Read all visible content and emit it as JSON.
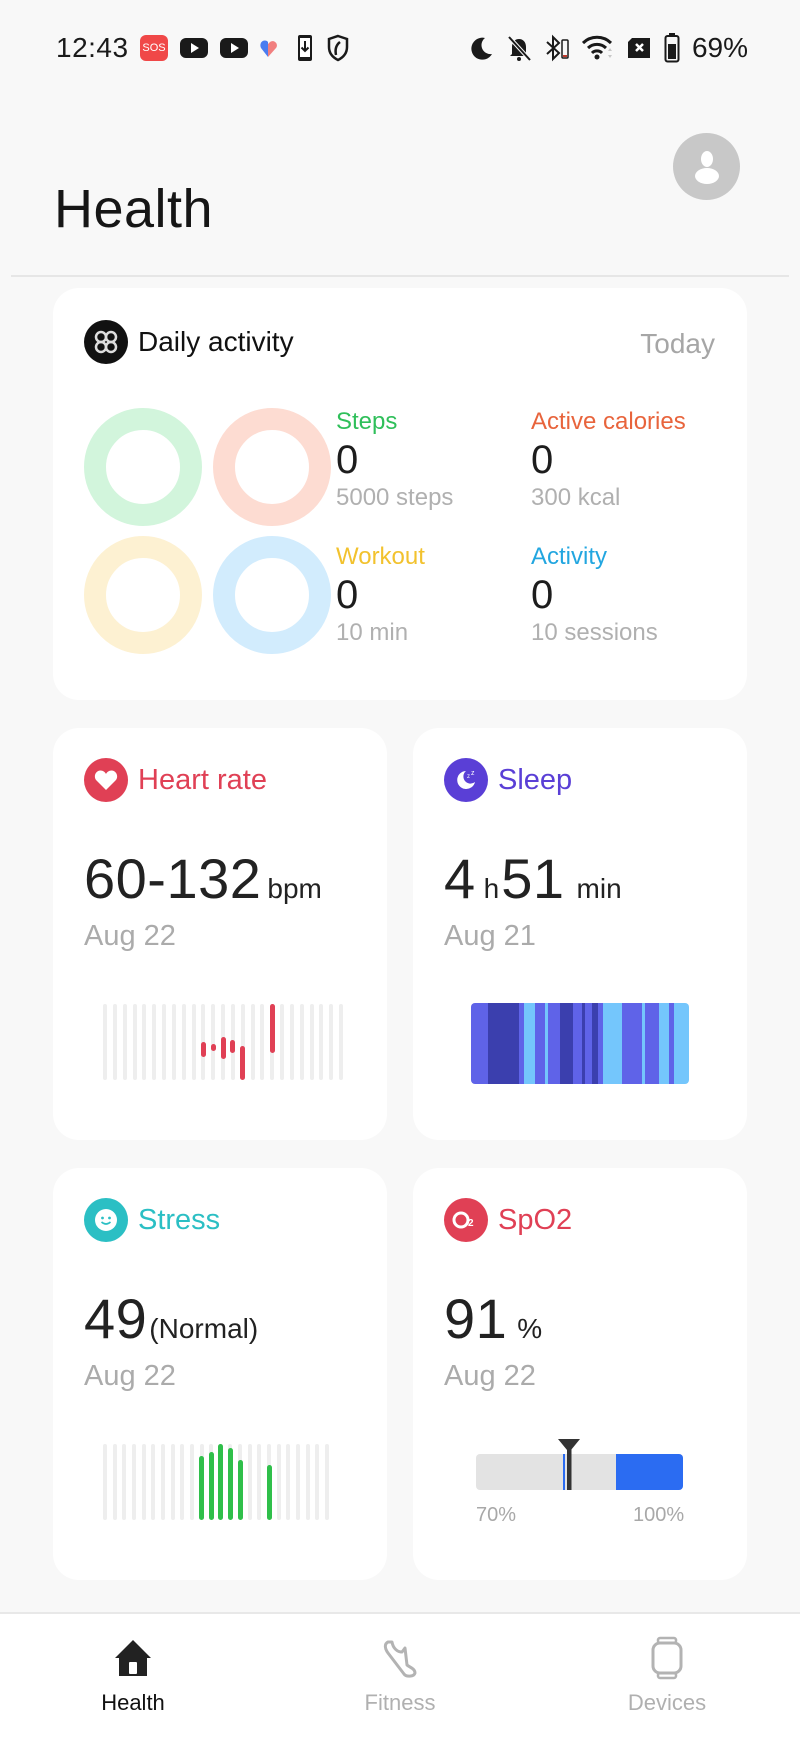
{
  "status_bar": {
    "time": "12:43",
    "left_icons": [
      "sos-icon",
      "youtube-icon",
      "youtube-icon",
      "health-heart-icon",
      "phone-download-icon",
      "shield-icon"
    ],
    "right_icons": [
      "do-not-disturb-moon-icon",
      "bell-muted-icon",
      "bluetooth-battery-icon",
      "wifi-icon",
      "no-sim-icon",
      "battery-icon"
    ],
    "sos_label": "SOS",
    "battery_percent": "69%"
  },
  "header": {
    "title": "Health",
    "avatar_icon": "user-avatar-icon"
  },
  "daily_activity": {
    "title": "Daily activity",
    "icon": "activity-rings-icon",
    "period": "Today",
    "metrics": [
      {
        "label": "Steps",
        "value": "0",
        "goal": "5000 steps",
        "color": "#2fbf5a",
        "ring_color": "#d2f5dc",
        "progress": 0
      },
      {
        "label": "Active calories",
        "value": "0",
        "goal": "300 kcal",
        "color": "#e8643c",
        "ring_color": "#fddcd2",
        "progress": 0
      },
      {
        "label": "Workout",
        "value": "0",
        "goal": "10 min",
        "color": "#f2c22e",
        "ring_color": "#fdf1d2",
        "progress": 0
      },
      {
        "label": "Activity",
        "value": "0",
        "goal": "10 sessions",
        "color": "#22a6e0",
        "ring_color": "#d2ecfd",
        "progress": 0
      }
    ]
  },
  "tiles": {
    "heart_rate": {
      "title": "Heart rate",
      "icon": "heart-icon",
      "color": "#e04055",
      "value": "60-132",
      "unit": "bpm",
      "date": "Aug 22",
      "bar_count": 25,
      "segments": [
        {
          "index": 10,
          "low": 0.3,
          "high": 0.5
        },
        {
          "index": 11,
          "low": 0.38,
          "high": 0.47
        },
        {
          "index": 12,
          "low": 0.28,
          "high": 0.57
        },
        {
          "index": 13,
          "low": 0.36,
          "high": 0.52
        },
        {
          "index": 14,
          "low": 0.0,
          "high": 0.45
        },
        {
          "index": 17,
          "low": 0.36,
          "high": 1.0
        }
      ]
    },
    "sleep": {
      "title": "Sleep",
      "icon": "moon-zzz-icon",
      "color": "#5a3fd6",
      "hours": "4",
      "hours_unit": "h",
      "minutes": "51",
      "minutes_unit": "min",
      "date": "Aug 21",
      "stage_colors": {
        "deep": "#3b3fae",
        "light": "#5f63e8",
        "rem": "#74c6fc"
      },
      "stages": [
        {
          "stage": "light",
          "fraction": 0.08
        },
        {
          "stage": "deep",
          "fraction": 0.147
        },
        {
          "stage": "light",
          "fraction": 0.022
        },
        {
          "stage": "rem",
          "fraction": 0.052
        },
        {
          "stage": "light",
          "fraction": 0.049
        },
        {
          "stage": "rem",
          "fraction": 0.015
        },
        {
          "stage": "light",
          "fraction": 0.058
        },
        {
          "stage": "deep",
          "fraction": 0.061
        },
        {
          "stage": "light",
          "fraction": 0.041
        },
        {
          "stage": "deep",
          "fraction": 0.015
        },
        {
          "stage": "light",
          "fraction": 0.034
        },
        {
          "stage": "deep",
          "fraction": 0.028
        },
        {
          "stage": "light",
          "fraction": 0.023
        },
        {
          "stage": "rem",
          "fraction": 0.087
        },
        {
          "stage": "light",
          "fraction": 0.097
        },
        {
          "stage": "rem",
          "fraction": 0.012
        },
        {
          "stage": "light",
          "fraction": 0.067
        },
        {
          "stage": "rem",
          "fraction": 0.049
        },
        {
          "stage": "light",
          "fraction": 0.025
        },
        {
          "stage": "rem",
          "fraction": 0.068
        }
      ]
    },
    "stress": {
      "title": "Stress",
      "icon": "smiley-face-icon",
      "color": "#2bbfc4",
      "value": "49",
      "status": "(Normal)",
      "date": "Aug 22",
      "bar_color": "#2fbf4a",
      "bar_count": 24,
      "bars": [
        {
          "index": 10,
          "level": 0.84
        },
        {
          "index": 11,
          "level": 0.9
        },
        {
          "index": 12,
          "level": 1.0
        },
        {
          "index": 13,
          "level": 0.95
        },
        {
          "index": 14,
          "level": 0.79
        },
        {
          "index": 17,
          "level": 0.72
        }
      ]
    },
    "spo2": {
      "title": "SpO2",
      "icon": "o2-icon",
      "color": "#e04055",
      "value": "91",
      "unit": "%",
      "date": "Aug 22",
      "range_min_label": "70%",
      "range_max_label": "100%",
      "range_min": 70,
      "range_max": 100,
      "normal_from": 90,
      "reading": 91
    }
  },
  "bottom_nav": [
    {
      "label": "Health",
      "icon": "home-icon",
      "active": true
    },
    {
      "label": "Fitness",
      "icon": "sneaker-icon",
      "active": false
    },
    {
      "label": "Devices",
      "icon": "smartwatch-icon",
      "active": false
    }
  ]
}
